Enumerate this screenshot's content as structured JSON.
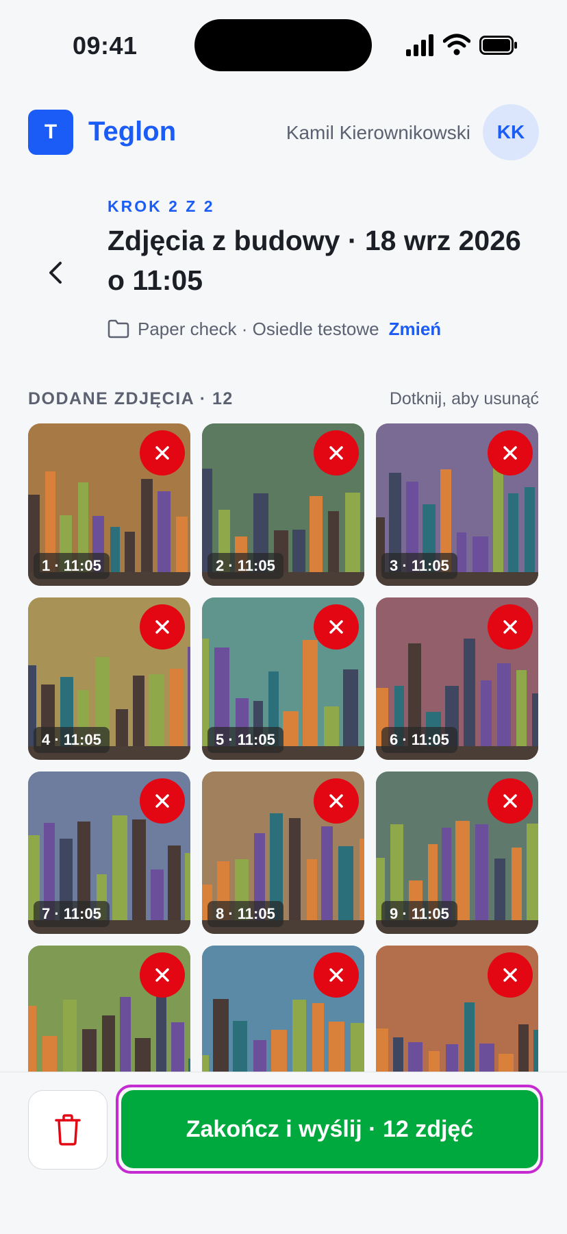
{
  "status_bar": {
    "time": "09:41"
  },
  "header": {
    "logo_letter": "T",
    "brand": "Teglon",
    "user_name": "Kamil Kierownikowski",
    "avatar_initials": "KK"
  },
  "step": {
    "label": "KROK 2 Z 2",
    "title": "Zdjęcia z budowy · 18 wrz 2026 o 11:05"
  },
  "project": {
    "name": "Paper check · Osiedle testowe",
    "change_label": "Zmień"
  },
  "photos_section": {
    "label": "DODANE ZDJĘCIA · 12",
    "hint": "Dotknij, aby usunąć"
  },
  "photos": [
    {
      "caption": "1 · 11:05",
      "bg": "#a77a45"
    },
    {
      "caption": "2 · 11:05",
      "bg": "#5b7a60"
    },
    {
      "caption": "3 · 11:05",
      "bg": "#7a6b94"
    },
    {
      "caption": "4 · 11:05",
      "bg": "#a89256"
    },
    {
      "caption": "5 · 11:05",
      "bg": "#5f958c"
    },
    {
      "caption": "6 · 11:05",
      "bg": "#935f6a"
    },
    {
      "caption": "7 · 11:05",
      "bg": "#6e7d9e"
    },
    {
      "caption": "8 · 11:05",
      "bg": "#a0805d"
    },
    {
      "caption": "9 · 11:05",
      "bg": "#5f7a6d"
    },
    {
      "caption": "",
      "bg": "#7f9a52"
    },
    {
      "caption": "",
      "bg": "#5a8aa6"
    },
    {
      "caption": "",
      "bg": "#b36e4c"
    }
  ],
  "actions": {
    "submit_label": "Zakończ i wyślij · 12 zdjęć"
  },
  "colors": {
    "accent": "#1a5cf5",
    "submit": "#00a93e",
    "delete": "#e30613"
  }
}
